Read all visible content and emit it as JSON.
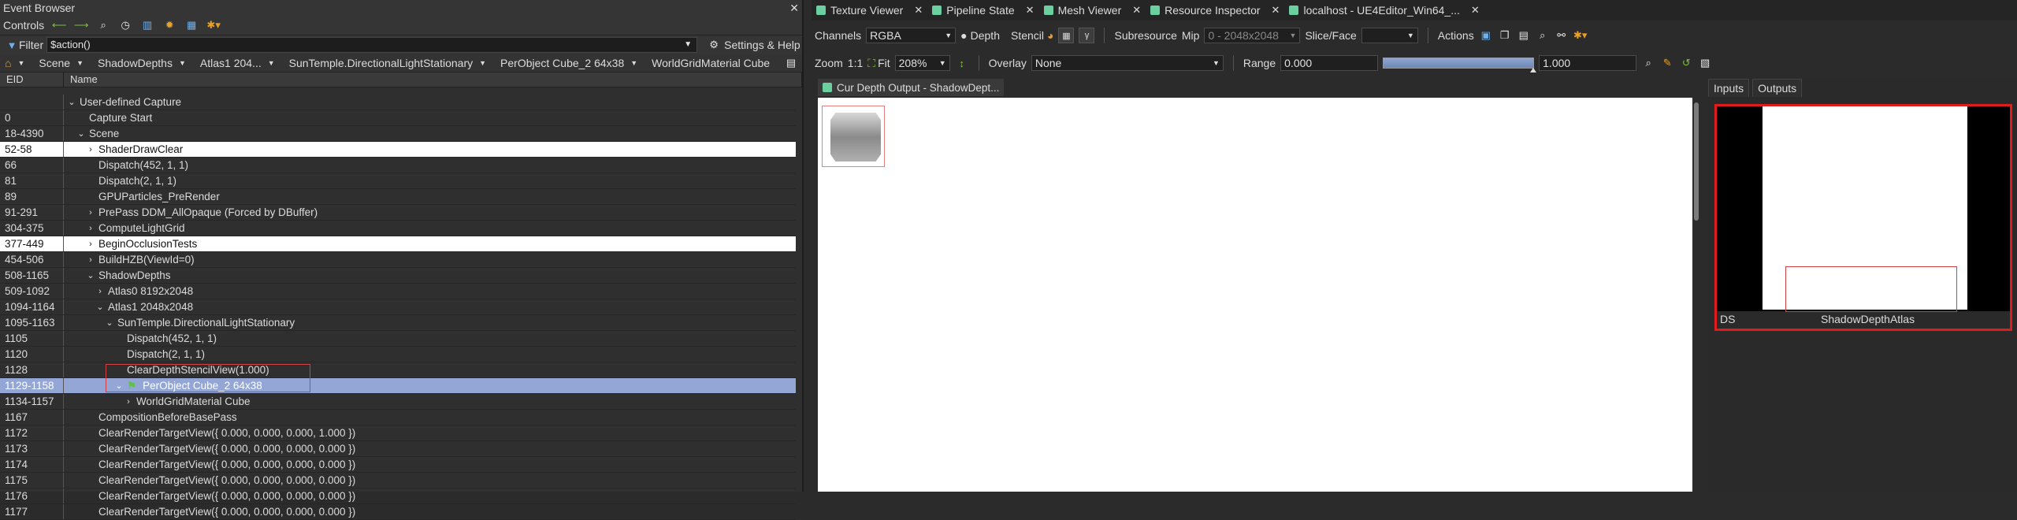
{
  "event_browser": {
    "title": "Event Browser",
    "close": "✕",
    "controls_label": "Controls",
    "filter_label": "Filter",
    "filter_value": "$action()",
    "settings_label": "Settings & Help",
    "breadcrumbs": [
      {
        "label": "Scene"
      },
      {
        "label": "ShadowDepths"
      },
      {
        "label": "Atlas1 204..."
      },
      {
        "label": "SunTemple.DirectionalLightStationary"
      },
      {
        "label": "PerObject Cube_2 64x38"
      },
      {
        "label": "WorldGridMaterial Cube"
      }
    ],
    "columns": [
      "EID",
      "Name"
    ],
    "rows": [
      {
        "eid": "",
        "indent": 0,
        "tree": "⌄",
        "name": "User-defined Capture",
        "style": "normal"
      },
      {
        "eid": "0",
        "indent": 1,
        "tree": "",
        "name": "Capture Start",
        "style": "normal"
      },
      {
        "eid": "18-4390",
        "indent": 1,
        "tree": "⌄",
        "name": "Scene",
        "style": "normal"
      },
      {
        "eid": "52-58",
        "indent": 2,
        "tree": "›",
        "name": "ShaderDrawClear",
        "style": "hl"
      },
      {
        "eid": "66",
        "indent": 2,
        "tree": "",
        "name": "Dispatch(452, 1, 1)",
        "style": "normal"
      },
      {
        "eid": "81",
        "indent": 2,
        "tree": "",
        "name": "Dispatch(2, 1, 1)",
        "style": "normal"
      },
      {
        "eid": "89",
        "indent": 2,
        "tree": "",
        "name": "GPUParticles_PreRender",
        "style": "normal"
      },
      {
        "eid": "91-291",
        "indent": 2,
        "tree": "›",
        "name": "PrePass DDM_AllOpaque (Forced by DBuffer)",
        "style": "normal"
      },
      {
        "eid": "304-375",
        "indent": 2,
        "tree": "›",
        "name": "ComputeLightGrid",
        "style": "normal"
      },
      {
        "eid": "377-449",
        "indent": 2,
        "tree": "›",
        "name": "BeginOcclusionTests",
        "style": "hl"
      },
      {
        "eid": "454-506",
        "indent": 2,
        "tree": "›",
        "name": "BuildHZB(ViewId=0)",
        "style": "normal"
      },
      {
        "eid": "508-1165",
        "indent": 2,
        "tree": "⌄",
        "name": "ShadowDepths",
        "style": "normal"
      },
      {
        "eid": "509-1092",
        "indent": 3,
        "tree": "›",
        "name": "Atlas0 8192x2048",
        "style": "normal"
      },
      {
        "eid": "1094-1164",
        "indent": 3,
        "tree": "⌄",
        "name": "Atlas1 2048x2048",
        "style": "normal"
      },
      {
        "eid": "1095-1163",
        "indent": 4,
        "tree": "⌄",
        "name": "SunTemple.DirectionalLightStationary",
        "style": "normal"
      },
      {
        "eid": "1105",
        "indent": 5,
        "tree": "",
        "name": "Dispatch(452, 1, 1)",
        "style": "normal"
      },
      {
        "eid": "1120",
        "indent": 5,
        "tree": "",
        "name": "Dispatch(2, 1, 1)",
        "style": "normal"
      },
      {
        "eid": "1128",
        "indent": 5,
        "tree": "",
        "name": "ClearDepthStencilView(1.000)",
        "style": "normal"
      },
      {
        "eid": "1129-1158",
        "indent": 5,
        "tree": "⌄",
        "name": "PerObject Cube_2 64x38",
        "style": "sel",
        "flag": true
      },
      {
        "eid": "1134-1157",
        "indent": 6,
        "tree": "›",
        "name": "WorldGridMaterial Cube",
        "style": "normal"
      },
      {
        "eid": "1167",
        "indent": 2,
        "tree": "",
        "name": "CompositionBeforeBasePass",
        "style": "normal"
      },
      {
        "eid": "1172",
        "indent": 2,
        "tree": "",
        "name": "ClearRenderTargetView({ 0.000, 0.000, 0.000, 1.000 })",
        "style": "normal"
      },
      {
        "eid": "1173",
        "indent": 2,
        "tree": "",
        "name": "ClearRenderTargetView({ 0.000, 0.000, 0.000, 0.000 })",
        "style": "normal"
      },
      {
        "eid": "1174",
        "indent": 2,
        "tree": "",
        "name": "ClearRenderTargetView({ 0.000, 0.000, 0.000, 0.000 })",
        "style": "normal"
      },
      {
        "eid": "1175",
        "indent": 2,
        "tree": "",
        "name": "ClearRenderTargetView({ 0.000, 0.000, 0.000, 0.000 })",
        "style": "normal"
      },
      {
        "eid": "1176",
        "indent": 2,
        "tree": "",
        "name": "ClearRenderTargetView({ 0.000, 0.000, 0.000, 0.000 })",
        "style": "normal"
      },
      {
        "eid": "1177",
        "indent": 2,
        "tree": "",
        "name": "ClearRenderTargetView({ 0.000, 0.000, 0.000, 0.000 })",
        "style": "normal"
      }
    ]
  },
  "tabs": [
    {
      "label": "Texture Viewer"
    },
    {
      "label": "Pipeline State"
    },
    {
      "label": "Mesh Viewer"
    },
    {
      "label": "Resource Inspector"
    },
    {
      "label": "localhost - UE4Editor_Win64_..."
    }
  ],
  "texture_viewer": {
    "channels_label": "Channels",
    "channels_value": "RGBA",
    "depth_label": "Depth",
    "stencil_label": "Stencil",
    "gamma_label": "γ",
    "subresource_label": "Subresource",
    "mip_label": "Mip",
    "mip_value": "0 - 2048x2048",
    "slice_label": "Slice/Face",
    "actions_label": "Actions",
    "zoom_label": "Zoom",
    "zoom_1to1": "1:1",
    "fit_label": "Fit",
    "zoom_value": "208%",
    "overlay_label": "Overlay",
    "overlay_value": "None",
    "range_label": "Range",
    "range_min": "0.000",
    "range_max": "1.000",
    "output_tab": "Cur Depth Output - ShadowDept..."
  },
  "thumbnails": {
    "inputs_tab": "Inputs",
    "outputs_tab": "Outputs",
    "slot_label": "DS",
    "texture_name": "ShadowDepthAtlas"
  },
  "colors": {
    "selection": "#93a6d6",
    "highlight": "#ffffff",
    "accent_red": "#e01b1b",
    "tab_icon": "#6ccfa0"
  }
}
